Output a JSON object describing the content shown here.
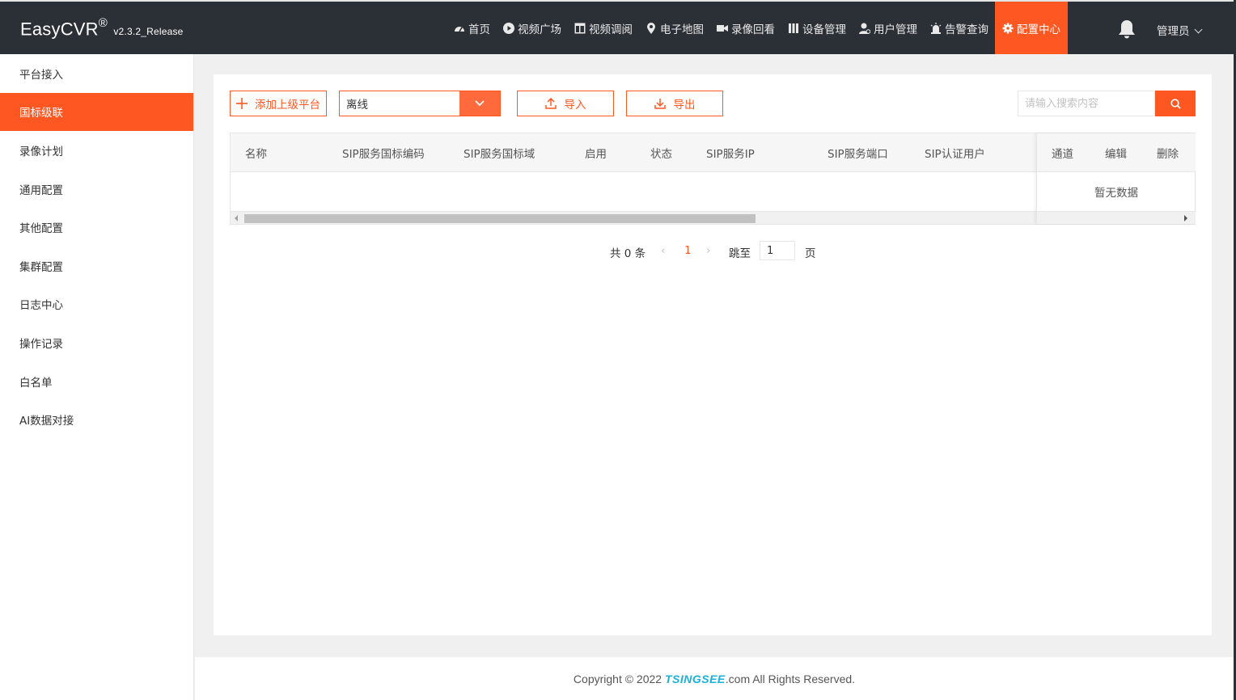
{
  "app": {
    "logo": "EasyCVR",
    "logo_mark": "®",
    "version": "v2.3.2_Release"
  },
  "colors": {
    "accent": "#ff5722",
    "topbar": "#2b2f36"
  },
  "nav": [
    {
      "label": "首页",
      "icon": "dashboard-icon"
    },
    {
      "label": "视频广场",
      "icon": "play-circle-icon"
    },
    {
      "label": "视频调阅",
      "icon": "layout-icon"
    },
    {
      "label": "电子地图",
      "icon": "map-pin-icon"
    },
    {
      "label": "录像回看",
      "icon": "video-camera-icon"
    },
    {
      "label": "设备管理",
      "icon": "device-bars-icon"
    },
    {
      "label": "用户管理",
      "icon": "user-gear-icon"
    },
    {
      "label": "告警查询",
      "icon": "alarm-icon"
    },
    {
      "label": "配置中心",
      "icon": "gear-icon",
      "active": true
    }
  ],
  "user": {
    "label": "管理员"
  },
  "sidebar": [
    {
      "label": "平台接入"
    },
    {
      "label": "国标级联",
      "active": true
    },
    {
      "label": "录像计划"
    },
    {
      "label": "通用配置"
    },
    {
      "label": "其他配置"
    },
    {
      "label": "集群配置"
    },
    {
      "label": "日志中心"
    },
    {
      "label": "操作记录"
    },
    {
      "label": "白名单"
    },
    {
      "label": "AI数据对接"
    }
  ],
  "toolbar": {
    "add_label": "添加上级平台",
    "status_select": "离线",
    "import_label": "导入",
    "export_label": "导出",
    "search_placeholder": "请输入搜索内容"
  },
  "table": {
    "columns": [
      "名称",
      "SIP服务国标编码",
      "SIP服务国标域",
      "启用",
      "状态",
      "SIP服务IP",
      "SIP服务端口",
      "SIP认证用户"
    ],
    "fixed_columns": [
      "通道",
      "编辑",
      "删除"
    ],
    "empty_text": "暂无数据",
    "rows": []
  },
  "pagination": {
    "total_text": "共 0 条",
    "current_page": "1",
    "jump_label": "跳至",
    "jump_value": "1",
    "page_unit": "页"
  },
  "footer": {
    "prefix": "Copyright © 2022 ",
    "brand": "TSINGSEE",
    "suffix": ".com All Rights Reserved."
  }
}
